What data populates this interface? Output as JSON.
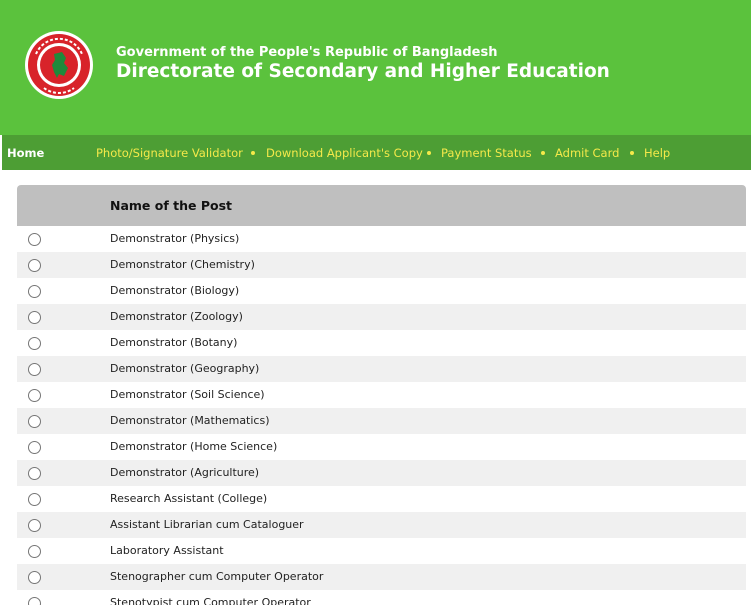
{
  "header": {
    "gov_title": "Government of the People's Republic of Bangladesh",
    "dir_title": "Directorate of Secondary and Higher Education",
    "logo_icon": "bangladesh-govt-seal-icon",
    "bg_color": "#5bc23d"
  },
  "nav": {
    "home": "Home",
    "photo_validator": "Photo/Signature Validator",
    "download_copy": "Download Applicant's Copy",
    "payment_status": "Payment Status",
    "admit_card": "Admit Card",
    "help": "Help",
    "bg_color": "#4d9e34",
    "link_color": "#f4e94a"
  },
  "table": {
    "header": "Name of the Post",
    "rows": [
      "Demonstrator (Physics)",
      "Demonstrator (Chemistry)",
      "Demonstrator (Biology)",
      "Demonstrator (Zoology)",
      "Demonstrator (Botany)",
      "Demonstrator (Geography)",
      "Demonstrator (Soil Science)",
      "Demonstrator (Mathematics)",
      "Demonstrator (Home Science)",
      "Demonstrator (Agriculture)",
      "Research Assistant (College)",
      "Assistant Librarian cum Cataloguer",
      "Laboratory Assistant",
      "Stenographer cum Computer Operator",
      "Stenotypist cum Computer Operator"
    ]
  }
}
